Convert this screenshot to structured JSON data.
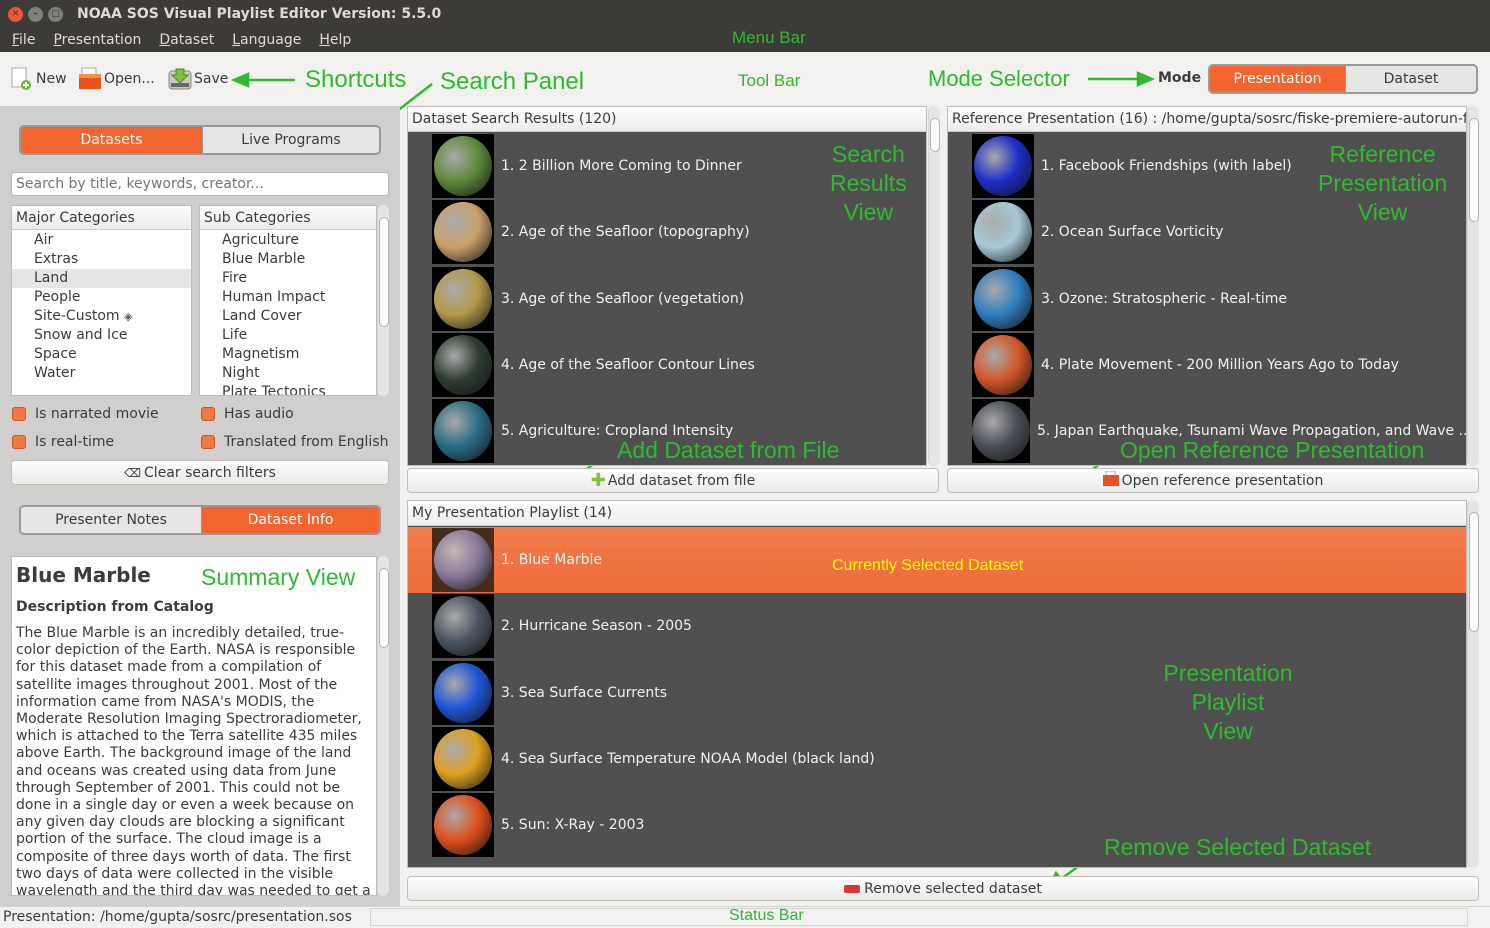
{
  "window": {
    "title": "NOAA SOS Visual Playlist Editor Version: 5.5.0"
  },
  "menubar": [
    "File",
    "Presentation",
    "Dataset",
    "Language",
    "Help"
  ],
  "toolbar": {
    "new_label": "New",
    "open_label": "Open...",
    "save_label": "Save",
    "mode_label": "Mode",
    "mode_options": [
      "Presentation",
      "Dataset"
    ],
    "mode_selected": "Presentation"
  },
  "search_panel": {
    "tabs": [
      "Datasets",
      "Live Programs"
    ],
    "active_tab": "Datasets",
    "search_placeholder": "Search by title, keywords, creator...",
    "search_value": "",
    "major_categories_header": "Major Categories",
    "major_categories": [
      "Air",
      "Extras",
      "Land",
      "People",
      "Site-Custom",
      "Snow and Ice",
      "Space",
      "Water"
    ],
    "major_selected": "Land",
    "sub_categories_header": "Sub Categories",
    "sub_categories": [
      "Agriculture",
      "Blue Marble",
      "Fire",
      "Human Impact",
      "Land Cover",
      "Life",
      "Magnetism",
      "Night",
      "Plate Tectonics"
    ],
    "filters": [
      {
        "label": "Is narrated movie",
        "checked": false
      },
      {
        "label": "Has audio",
        "checked": false
      },
      {
        "label": "Is real-time",
        "checked": false
      },
      {
        "label": "Translated from English",
        "checked": false
      }
    ],
    "clear_filters_label": "Clear search filters"
  },
  "info_panel": {
    "tabs": [
      "Presenter Notes",
      "Dataset Info"
    ],
    "active_tab": "Dataset Info",
    "title": "Blue Marble",
    "subtitle": "Description from Catalog",
    "body": "The Blue Marble is an incredibly detailed, true-color depiction of the Earth. NASA is responsible for this dataset made from a compilation of satellite images throughout 2001. Most of the information came from NASA's MODIS, the Moderate Resolution Imaging Spectroradiometer, which is attached to the Terra satellite 435 miles above Earth. The background image of the land and oceans was created using data from June through September of 2001. This could not be done in a single day or even a week because on any given day clouds are blocking a significant portion of the surface. The cloud image is a composite of three days worth of data. The first two days of data were collected in the visible wavelength and the third day was needed to get a view of the clouds over the poles using"
  },
  "search_results": {
    "header": "Dataset Search Results (120)",
    "items": [
      {
        "label": "1. 2 Billion More Coming to Dinner",
        "thumb_color": "#5f8a3a"
      },
      {
        "label": "2. Age of the Seafloor (topography)",
        "thumb_color": "#c9a06a"
      },
      {
        "label": "3. Age of the Seafloor (vegetation)",
        "thumb_color": "#b39a4a"
      },
      {
        "label": "4. Age of the Seafloor Contour Lines",
        "thumb_color": "#2e3d33"
      },
      {
        "label": "5. Agriculture: Cropland Intensity",
        "thumb_color": "#2a6d85"
      }
    ],
    "add_button_label": "Add dataset from file"
  },
  "reference": {
    "header": "Reference Presentation (16) : /home/gupta/sosrc/fiske-premiere-autorun-fi",
    "items": [
      {
        "label": "1. Facebook Friendships (with label)",
        "thumb_color": "#1c2fc9"
      },
      {
        "label": "2. Ocean Surface Vorticity",
        "thumb_color": "#a7c9d6"
      },
      {
        "label": "3. Ozone: Stratospheric - Real-time",
        "thumb_color": "#2f7ec0"
      },
      {
        "label": "4. Plate Movement - 200 Million Years Ago to Today",
        "thumb_color": "#d4562a"
      },
      {
        "label": "5. Japan Earthquake, Tsunami Wave Propagation, and Wave ...",
        "thumb_color": "#4a4e55"
      }
    ],
    "open_button_label": "Open reference presentation"
  },
  "playlist": {
    "header": "My Presentation Playlist (14)",
    "selected_index": 0,
    "items": [
      {
        "label": "1. Blue Marble",
        "thumb_color": "#8a7a9a"
      },
      {
        "label": "2. Hurricane Season - 2005",
        "thumb_color": "#4b5560"
      },
      {
        "label": "3. Sea Surface Currents",
        "thumb_color": "#1e55d8"
      },
      {
        "label": "4. Sea Surface Temperature NOAA Model (black land)",
        "thumb_color": "#e0a020"
      },
      {
        "label": "5. Sun: X-Ray - 2003",
        "thumb_color": "#e0501a"
      }
    ],
    "remove_button_label": "Remove selected dataset"
  },
  "statusbar": {
    "text": "Presentation:  /home/gupta/sosrc/presentation.sos"
  },
  "annotations": {
    "menu_bar": "Menu Bar",
    "shortcuts": "Shortcuts",
    "search_panel": "Search Panel",
    "tool_bar": "Tool Bar",
    "mode_selector": "Mode Selector",
    "search_results_view": [
      "Search",
      "Results",
      "View"
    ],
    "reference_view": [
      "Reference",
      "Presentation",
      "View"
    ],
    "add_dataset": "Add Dataset from File",
    "open_reference": "Open Reference Presentation",
    "selected_dataset": "Currently Selected Dataset",
    "summary_view": "Summary View",
    "playlist_view": [
      "Presentation",
      "Playlist",
      "View"
    ],
    "remove_dataset": "Remove Selected Dataset",
    "status_bar": "Status Bar"
  },
  "colors": {
    "accent": "#f26430",
    "annotation_green": "#2dbb2d",
    "annotation_yellow": "#ffff00",
    "list_background": "#505050"
  }
}
